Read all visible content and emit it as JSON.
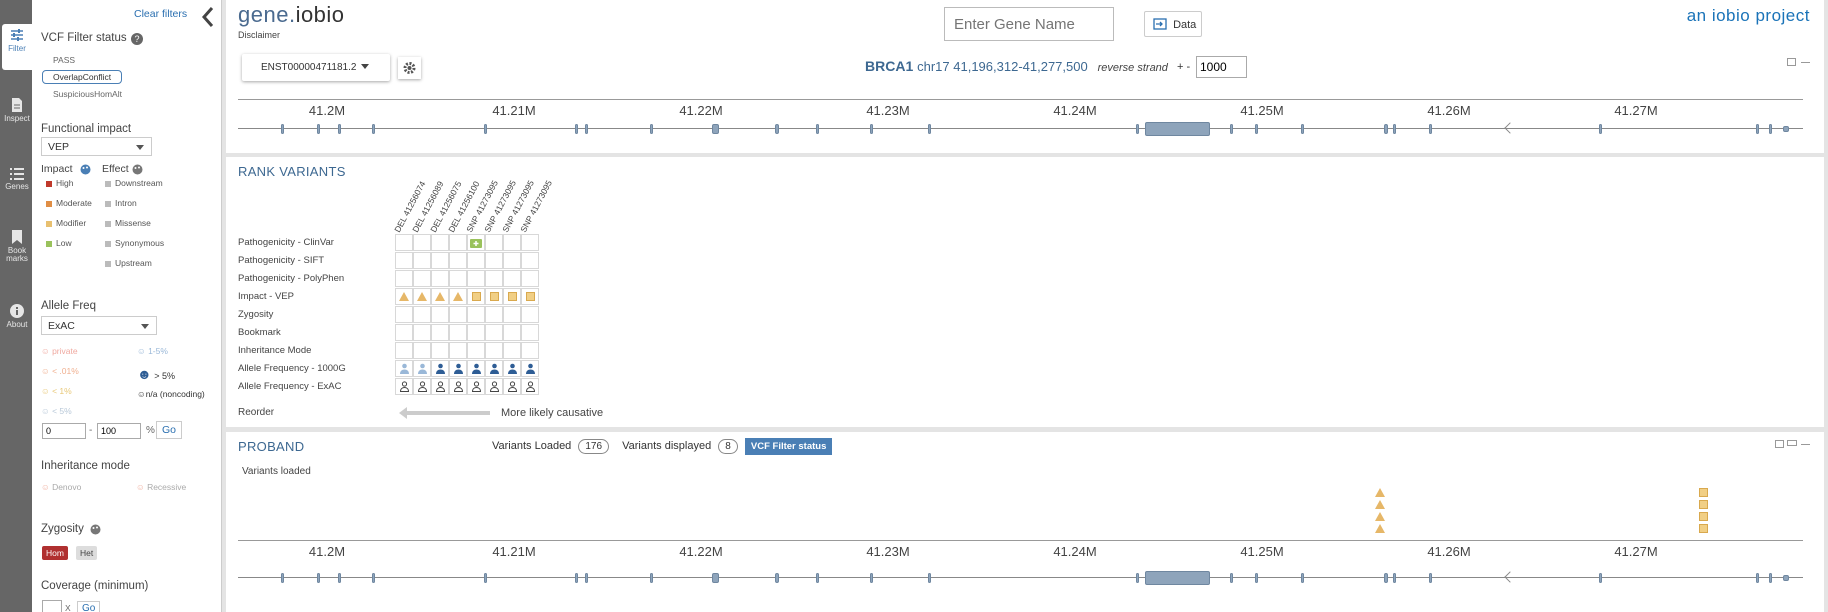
{
  "nav": {
    "items": [
      {
        "label": "Filter",
        "active": true
      },
      {
        "label": "Inspect"
      },
      {
        "label": "Genes"
      },
      {
        "label": "Book marks"
      },
      {
        "label": "About"
      }
    ]
  },
  "sidebar": {
    "clear_filters": "Clear filters",
    "vcf_filter_title": "VCF Filter status",
    "vcf_options": [
      "PASS",
      "OverlapConflict",
      "SuspiciousHomAlt"
    ],
    "functional_impact_title": "Functional impact",
    "functional_impact_value": "VEP",
    "impact_title": "Impact",
    "effect_title": "Effect",
    "impacts": [
      {
        "label": "High",
        "color": "#c0392b"
      },
      {
        "label": "Moderate",
        "color": "#e08e45"
      },
      {
        "label": "Modifier",
        "color": "#e8c070"
      },
      {
        "label": "Low",
        "color": "#9ac25c"
      }
    ],
    "effects": [
      "Downstream",
      "Intron",
      "Missense",
      "Synonymous",
      "Upstream"
    ],
    "allele_freq_title": "Allele Freq",
    "allele_freq_value": "ExAC",
    "af_left": [
      "private",
      "< .01%",
      "< 1%",
      "< 5%"
    ],
    "af_right": [
      "1-5%",
      "> 5%",
      "n/a (noncoding)"
    ],
    "af_min": "0",
    "af_max": "100",
    "af_dash": "-",
    "af_unit": "%",
    "af_go": "Go",
    "inheritance_title": "Inheritance mode",
    "inheritance": [
      "Denovo",
      "Recessive"
    ],
    "zygosity_title": "Zygosity",
    "zygosity": [
      "Hom",
      "Het"
    ],
    "coverage_title": "Coverage (minimum)",
    "coverage_x": "X",
    "coverage_go": "Go"
  },
  "header": {
    "logo_a": "gene.",
    "logo_b": "iobio",
    "disclaimer": "Disclaimer",
    "gene_placeholder": "Enter Gene Name",
    "data_button": "Data",
    "brand": "an iobio project",
    "transcript": "ENST00000471181.2",
    "gene": "BRCA1",
    "locus": "chr17 41,196,312-41,277,500",
    "strand": "reverse strand",
    "pm": "+ -",
    "window": "1000"
  },
  "axis_ticks": [
    "41.2M",
    "41.21M",
    "41.22M",
    "41.23M",
    "41.24M",
    "41.25M",
    "41.26M",
    "41.27M"
  ],
  "rank": {
    "title": "RANK VARIANTS",
    "columns": [
      "DEL 41256074",
      "DEL 41256089",
      "DEL 41256075",
      "DEL 41256100",
      "SNP 41273095",
      "SNP 41273095",
      "SNP 41273095",
      "SNP 41273095"
    ],
    "rows": [
      "Pathogenicity - ClinVar",
      "Pathogenicity - SIFT",
      "Pathogenicity - PolyPhen",
      "Impact - VEP",
      "Zygosity",
      "Bookmark",
      "Inheritance Mode",
      "Allele Frequency - 1000G",
      "Allele Frequency - ExAC"
    ],
    "reorder": "Reorder",
    "causative": "More likely causative"
  },
  "proband": {
    "title": "PROBAND",
    "variants_loaded_label": "Variants Loaded",
    "variants_loaded": "176",
    "variants_displayed_label": "Variants displayed",
    "variants_displayed": "8",
    "filter_badge": "VCF Filter status",
    "variants_loaded_note": "Variants loaded"
  },
  "colors": {
    "accent": "#4a7fb5",
    "brand_blue": "#1a73b8",
    "triangle": "#e6b768",
    "square": "#f1cf85",
    "hom": "#b03030"
  }
}
